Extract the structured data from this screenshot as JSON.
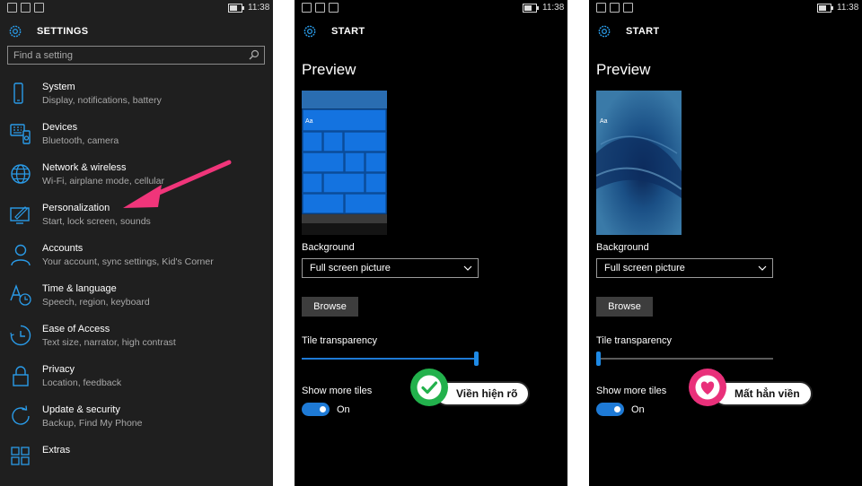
{
  "status": {
    "time": "11:38"
  },
  "settings": {
    "title": "SETTINGS",
    "search_placeholder": "Find a setting",
    "items": [
      {
        "title": "System",
        "subtitle": "Display, notifications, battery",
        "icon": "system-icon"
      },
      {
        "title": "Devices",
        "subtitle": "Bluetooth, camera",
        "icon": "devices-icon"
      },
      {
        "title": "Network & wireless",
        "subtitle": "Wi-Fi, airplane mode, cellular",
        "icon": "globe-icon"
      },
      {
        "title": "Personalization",
        "subtitle": "Start, lock screen, sounds",
        "icon": "personalization-icon"
      },
      {
        "title": "Accounts",
        "subtitle": "Your account, sync settings, Kid's Corner",
        "icon": "person-icon"
      },
      {
        "title": "Time & language",
        "subtitle": "Speech, region, keyboard",
        "icon": "time-language-icon"
      },
      {
        "title": "Ease of Access",
        "subtitle": "Text size, narrator, high contrast",
        "icon": "ease-of-access-icon"
      },
      {
        "title": "Privacy",
        "subtitle": "Location, feedback",
        "icon": "lock-icon"
      },
      {
        "title": "Update & security",
        "subtitle": "Backup, Find My Phone",
        "icon": "update-icon"
      },
      {
        "title": "Extras",
        "subtitle": "",
        "icon": "extras-icon"
      }
    ]
  },
  "start_left": {
    "title": "START",
    "preview_label": "Preview",
    "thumb_text": "Aa",
    "background_label": "Background",
    "background_value": "Full screen picture",
    "browse_label": "Browse",
    "transparency_label": "Tile transparency",
    "transparency_value": 1.0,
    "more_tiles_label": "Show more tiles",
    "more_tiles_state": "On",
    "annotation": "Viền hiện rõ"
  },
  "start_right": {
    "title": "START",
    "preview_label": "Preview",
    "thumb_text": "Aa",
    "background_label": "Background",
    "background_value": "Full screen picture",
    "browse_label": "Browse",
    "transparency_label": "Tile transparency",
    "transparency_value": 0.0,
    "more_tiles_label": "Show more tiles",
    "more_tiles_state": "On",
    "annotation": "Mất hẳn viền"
  },
  "colors": {
    "accent": "#1e7ad6",
    "arrow": "#f0357a",
    "check_badge": "#22b14c",
    "heart_badge": "#e9307a"
  }
}
